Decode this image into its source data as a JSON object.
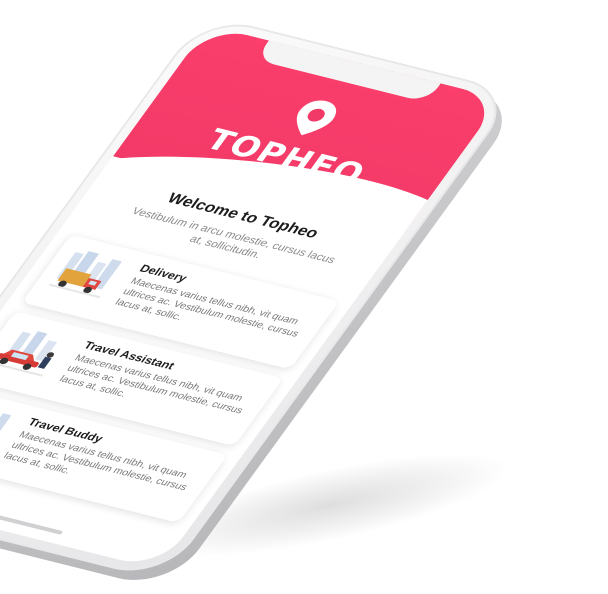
{
  "app": {
    "brand": "TOPHEO",
    "accent_color": "#f23a68",
    "logo_icon": "map-pin-icon"
  },
  "main": {
    "welcome_title": "Welcome to Topheo",
    "welcome_subtitle": "Vestibulum in arcu molestie, cursus lacus at, sollicitudin."
  },
  "services": [
    {
      "title": "Delivery",
      "description": "Maecenas varius tellus nibh, vit quam ultrices ac. Vestibulum molestie, cursus lacus at, sollic.",
      "illustration": "delivery-truck-illustration"
    },
    {
      "title": "Travel Assistant",
      "description": "Maecenas varius tellus nibh, vit quam ultrices ac. Vestibulum molestie, cursus lacus at, sollic.",
      "illustration": "red-car-illustration"
    },
    {
      "title": "Travel Buddy",
      "description": "Maecenas varius tellus nibh, vit quam ultrices ac. Vestibulum molestie, cursus lacus at, sollic.",
      "illustration": "travelers-illustration"
    }
  ]
}
